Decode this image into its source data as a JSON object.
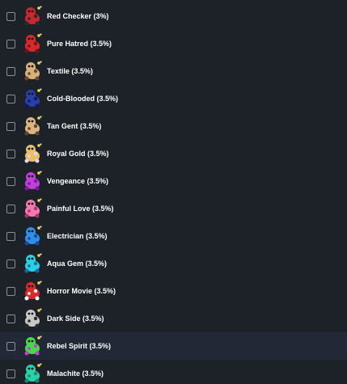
{
  "items": [
    {
      "label": "Red Checker (3%)",
      "icon": "red-checker-icon",
      "color": "#c8282f",
      "accent": "#2b2b2b"
    },
    {
      "label": "Pure Hatred (3.5%)",
      "icon": "pure-hatred-icon",
      "color": "#d42a2a",
      "accent": "#7a1010"
    },
    {
      "label": "Textile (3.5%)",
      "icon": "textile-icon",
      "color": "#d8b07a",
      "accent": "#6b4b2a"
    },
    {
      "label": "Cold-Blooded (3.5%)",
      "icon": "cold-blooded-icon",
      "color": "#2a3fa8",
      "accent": "#0e1a5c"
    },
    {
      "label": "Tan Gent (3.5%)",
      "icon": "tan-gent-icon",
      "color": "#e0b482",
      "accent": "#5a4630"
    },
    {
      "label": "Royal Gold (3.5%)",
      "icon": "royal-gold-icon",
      "color": "#e6c06a",
      "accent": "#f0d0e0"
    },
    {
      "label": "Vengeance (3.5%)",
      "icon": "vengeance-icon",
      "color": "#c040d8",
      "accent": "#7a1a9c"
    },
    {
      "label": "Painful Love (3.5%)",
      "icon": "painful-love-icon",
      "color": "#f07ab0",
      "accent": "#b0306a"
    },
    {
      "label": "Electrician (3.5%)",
      "icon": "electrician-icon",
      "color": "#2f90e8",
      "accent": "#1a4aa0"
    },
    {
      "label": "Aqua Gem (3.5%)",
      "icon": "aqua-gem-icon",
      "color": "#2ad0e0",
      "accent": "#1a6ab0"
    },
    {
      "label": "Horror Movie (3.5%)",
      "icon": "horror-movie-icon",
      "color": "#d82a2a",
      "accent": "#ffffff"
    },
    {
      "label": "Dark Side (3.5%)",
      "icon": "dark-side-icon",
      "color": "#c8c8c8",
      "accent": "#2a2a2a"
    },
    {
      "label": "Rebel Spirit (3.5%)",
      "icon": "rebel-spirit-icon",
      "color": "#48d84a",
      "accent": "#c040d0"
    },
    {
      "label": "Malachite (3.5%)",
      "icon": "malachite-icon",
      "color": "#2ad0a8",
      "accent": "#1a8a6a"
    }
  ],
  "highlighted_index": 12,
  "colors": {
    "background": "#1d2128",
    "highlight_background": "#222836",
    "checkbox_border": "#8a8f99",
    "text": "#ffffff"
  }
}
